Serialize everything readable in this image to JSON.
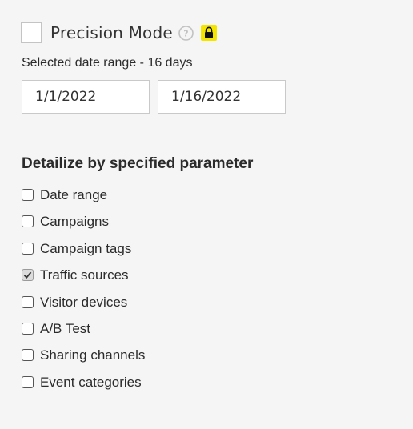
{
  "precision_mode": {
    "label": "Precision Mode",
    "checked": false,
    "help_icon": "question-circle-icon",
    "lock_icon": "lock-icon",
    "lock_badge_color": "#f5e400"
  },
  "date_range": {
    "label": "Selected date range - 16 days",
    "start": "1/1/2022",
    "end": "1/16/2022"
  },
  "detailize": {
    "heading": "Detailize by specified parameter",
    "options": [
      {
        "label": "Date range",
        "checked": false
      },
      {
        "label": "Campaigns",
        "checked": false
      },
      {
        "label": "Campaign tags",
        "checked": false
      },
      {
        "label": "Traffic sources",
        "checked": true
      },
      {
        "label": "Visitor devices",
        "checked": false
      },
      {
        "label": "A/B Test",
        "checked": false
      },
      {
        "label": "Sharing channels",
        "checked": false
      },
      {
        "label": "Event categories",
        "checked": false
      }
    ]
  }
}
